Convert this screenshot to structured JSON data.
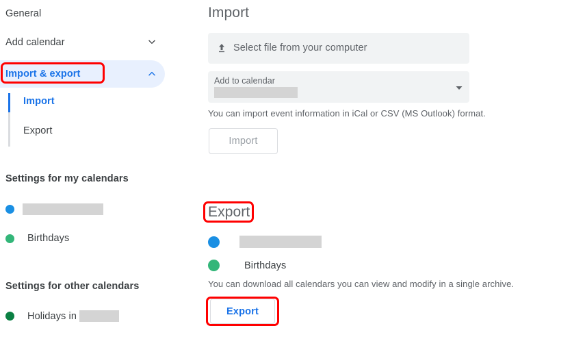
{
  "sidebar": {
    "items": [
      {
        "label": "General",
        "icon": null,
        "state": "idle"
      },
      {
        "label": "Add calendar",
        "icon": "chevron-down-icon",
        "state": "collapsed"
      },
      {
        "label": "Import & export",
        "icon": "chevron-up-icon",
        "state": "selected"
      }
    ],
    "sub_items": [
      {
        "label": "Import",
        "state": "active"
      },
      {
        "label": "Export",
        "state": "idle"
      }
    ],
    "my_calendars_heading": "Settings for my calendars",
    "my_calendars": [
      {
        "name": "",
        "redacted": true,
        "color": "#1a8fe3"
      },
      {
        "name": "Birthdays",
        "redacted": false,
        "color": "#33b679"
      }
    ],
    "other_calendars_heading": "Settings for other calendars",
    "other_calendars": [
      {
        "name": "Holidays in",
        "redacted": true,
        "color": "#0b8043"
      }
    ]
  },
  "import": {
    "title": "Import",
    "file_picker_label": "Select file from your computer",
    "file_picker_icon": "upload-icon",
    "add_to_calendar_label": "Add to calendar",
    "add_to_calendar_value": "",
    "add_to_calendar_redacted": true,
    "dropdown_icon": "caret-down-icon",
    "helper_text": "You can import event information in iCal or CSV (MS Outlook) format.",
    "button_label": "Import",
    "button_disabled": true
  },
  "export": {
    "title": "Export",
    "calendars": [
      {
        "name": "",
        "redacted": true,
        "color": "#1a8fe3"
      },
      {
        "name": "Birthdays",
        "redacted": false,
        "color": "#33b679"
      }
    ],
    "helper_text": "You can download all calendars you can view and modify in a single archive.",
    "button_label": "Export"
  },
  "annotations": {
    "color": "#ff0000",
    "boxes": [
      {
        "target": "sidebar-item-import-export"
      },
      {
        "target": "export-section-title"
      },
      {
        "target": "export-button"
      }
    ]
  }
}
